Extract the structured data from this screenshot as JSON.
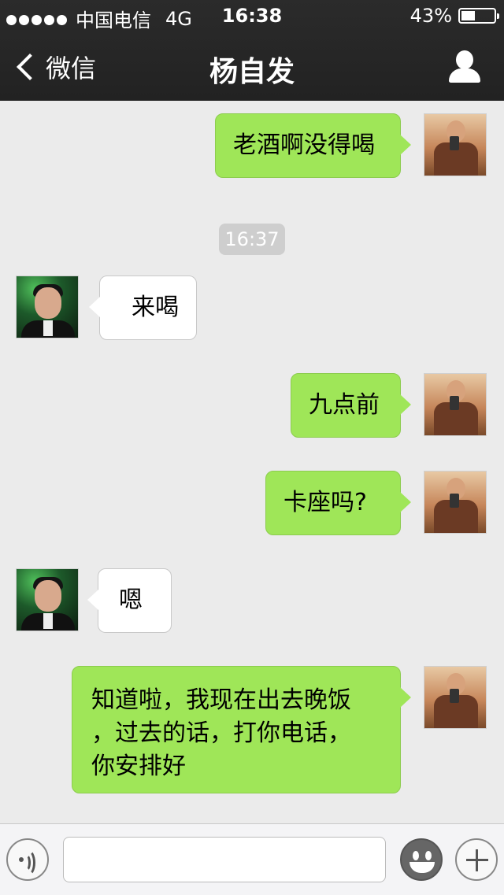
{
  "status_bar": {
    "carrier": "中国电信",
    "network": "4G",
    "time": "16:38",
    "battery": "43%",
    "battery_level": 0.43
  },
  "nav": {
    "back_label": "微信",
    "title": "杨自发"
  },
  "chat": {
    "messages": [
      {
        "from": "me",
        "text": "老酒啊没得喝"
      },
      {
        "from": "other",
        "text": "来喝"
      },
      {
        "from": "me",
        "text": "九点前"
      },
      {
        "from": "me",
        "text": "卡座吗?"
      },
      {
        "from": "other",
        "text": "嗯"
      },
      {
        "from": "me",
        "lines": [
          "知道啦，我现在出去晚饭",
          "，过去的话，打你电话，",
          "你安排好"
        ]
      }
    ],
    "timestamp": "16:37"
  },
  "colors": {
    "outgoing_bubble": "#9fe658",
    "incoming_bubble": "#ffffff",
    "nav_background": "#262626",
    "chat_background": "#ebebeb"
  },
  "icons": {
    "back": "chevron-left-icon",
    "profile": "person-icon",
    "voice": "voice-icon",
    "emoji": "smiley-icon",
    "more": "plus-icon"
  }
}
